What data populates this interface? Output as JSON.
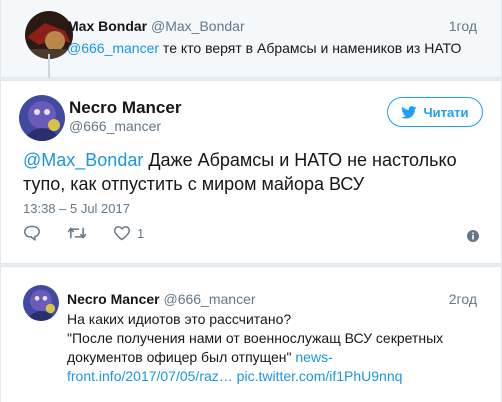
{
  "colors": {
    "link": "#1b95e0",
    "accent": "#1da1f2",
    "muted": "#657786",
    "text": "#14171a"
  },
  "parent": {
    "name": "Max Bondar",
    "handle": "@Max_Bondar",
    "time": "1год",
    "mention": "@666_mancer",
    "text": " те кто верят в Абрамсы и намеников из НАТО"
  },
  "main": {
    "name": "Necro Mancer",
    "handle": "@666_mancer",
    "follow_label": "Читати",
    "mention": "@Max_Bondar",
    "text": " Даже Абрамсы и НАТО не настолько тупо, как отпустить с миром майора ВСУ",
    "timestamp": "13:38 – 5 Jul 2017",
    "likes": "1"
  },
  "reply": {
    "name": "Necro Mancer",
    "handle": "@666_mancer",
    "time": "2год",
    "line1": "На каких идиотов это рассчитано?",
    "line2": "\"После получения нами от военнослужащ ВСУ секретных",
    "line3a": "документов офицер был отпущен\" ",
    "link1a": "news-",
    "link1b": "front.info/2017/07/05/raz…",
    "link2": "pic.twitter.com/if1PhU9nnq"
  }
}
